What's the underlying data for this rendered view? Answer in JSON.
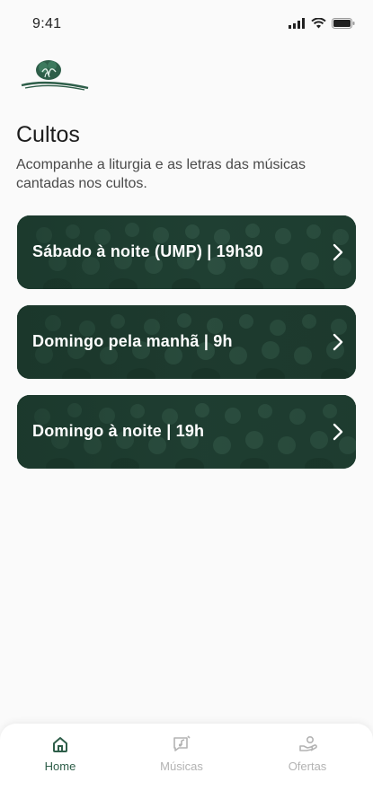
{
  "status_bar": {
    "time": "9:41",
    "icons": [
      "signal-icon",
      "wifi-icon",
      "battery-icon"
    ]
  },
  "header": {
    "logo": "church-tree-logo",
    "title": "Cultos",
    "subtitle": "Acompanhe a liturgia e as letras das músicas cantadas nos cultos."
  },
  "services": [
    {
      "label": "Sábado à noite (UMP) | 19h30"
    },
    {
      "label": "Domingo pela manhã | 9h"
    },
    {
      "label": "Domingo à noite | 19h"
    }
  ],
  "tab_bar": {
    "tabs": [
      {
        "label": "Home",
        "icon": "home-icon",
        "active": true
      },
      {
        "label": "Músicas",
        "icon": "music-icon",
        "active": false
      },
      {
        "label": "Ofertas",
        "icon": "offering-icon",
        "active": false
      }
    ]
  },
  "colors": {
    "brand_green": "#2e5e49",
    "card_green": "#1e3f32",
    "inactive_tab": "#b3b3b3"
  }
}
